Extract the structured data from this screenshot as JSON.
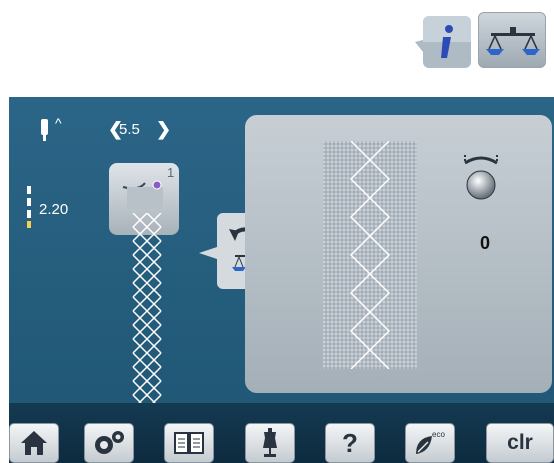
{
  "stitch": {
    "width_value": "5.5",
    "width_left_arrow": "❮",
    "width_right_arrow": "❯",
    "needle_arrow": "^",
    "length_value": "2.20",
    "number": "1"
  },
  "tension": {
    "value": "0"
  },
  "toolbar": {
    "clr_label": "clr",
    "help_label": "?",
    "eco_label": "eco"
  },
  "icons": [
    "info-icon",
    "balance-icon",
    "home-icon",
    "settings-icon",
    "book-icon",
    "dress-form-icon",
    "help-icon",
    "eco-icon",
    "clr-icon"
  ],
  "colors": {
    "screen": "#2b6587",
    "panel": "#b7c0c7",
    "toolbar": "#143a52"
  }
}
